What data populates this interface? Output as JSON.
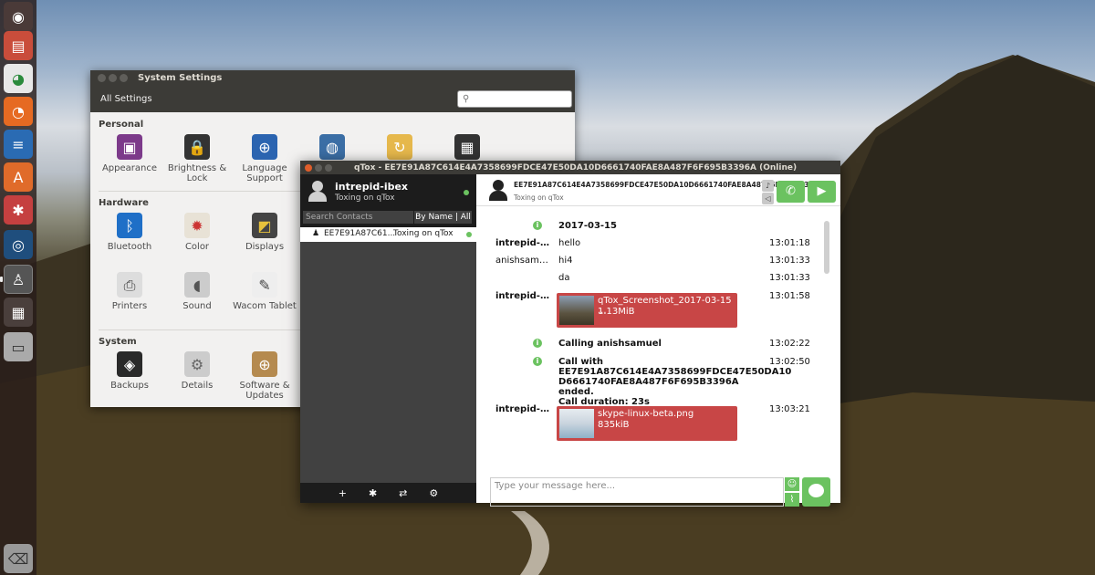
{
  "system_settings": {
    "title": "System Settings",
    "all_settings": "All Settings",
    "sections": {
      "personal": "Personal",
      "hardware": "Hardware",
      "system": "System"
    },
    "personal_items": [
      "Appearance",
      "Brightness & Lock",
      "Language Support"
    ],
    "hardware_items": [
      "Bluetooth",
      "Color",
      "Displays",
      "Printers",
      "Sound",
      "Wacom Tablet"
    ],
    "system_items": [
      "Backups",
      "Details",
      "Software & Updates"
    ]
  },
  "qtox": {
    "title": "qTox - EE7E91A87C614E4A7358699FDCE47E50DA10D6661740FAE8A487F6F695B3396A (Online)",
    "profile": {
      "name": "intrepid-ibex",
      "status": "Toxing on qTox"
    },
    "search_placeholder": "Search Contacts",
    "sort_label": "By Name | All",
    "contact": {
      "name": "EE7E91A87C61...",
      "status": "Toxing on qTox"
    },
    "bottom_icons": [
      "+",
      "✱",
      "⇄",
      "⚙"
    ],
    "header": {
      "id": "EE7E91A87C614E4A7358699FDCE47E50DA10D6661740FAE8A487F6F695B3396A",
      "status": "Toxing on qTox"
    },
    "date": "2017-03-15",
    "messages": [
      {
        "who": "intrepid-i...",
        "text": "hello",
        "time": "13:01:18"
      },
      {
        "who": "anishsamuel",
        "text": "hi4",
        "time": "13:01:33"
      },
      {
        "who": "",
        "text": "da",
        "time": "13:01:33"
      },
      {
        "who": "intrepid-i...",
        "time": "13:01:58"
      },
      {
        "text": "Calling anishsamuel",
        "time": "13:02:22"
      },
      {
        "text": "Call with\nEE7E91A87C614E4A7358699FDCE47E50DA10\nD6661740FAE8A487F6F695B3396A ended.\nCall duration: 23s",
        "time": "13:02:50"
      },
      {
        "who": "intrepid-i...",
        "time": "13:03:21"
      }
    ],
    "files": [
      {
        "name": "qTox_Screenshot_2017-03-15 ...",
        "size": "1.13MiB"
      },
      {
        "name": "skype-linux-beta.png",
        "size": "835kiB"
      }
    ],
    "input_placeholder": "Type your message here..."
  },
  "colors": {
    "accent_green": "#6bc260",
    "file_red": "#c84646",
    "titlebar": "#3c3b37"
  }
}
